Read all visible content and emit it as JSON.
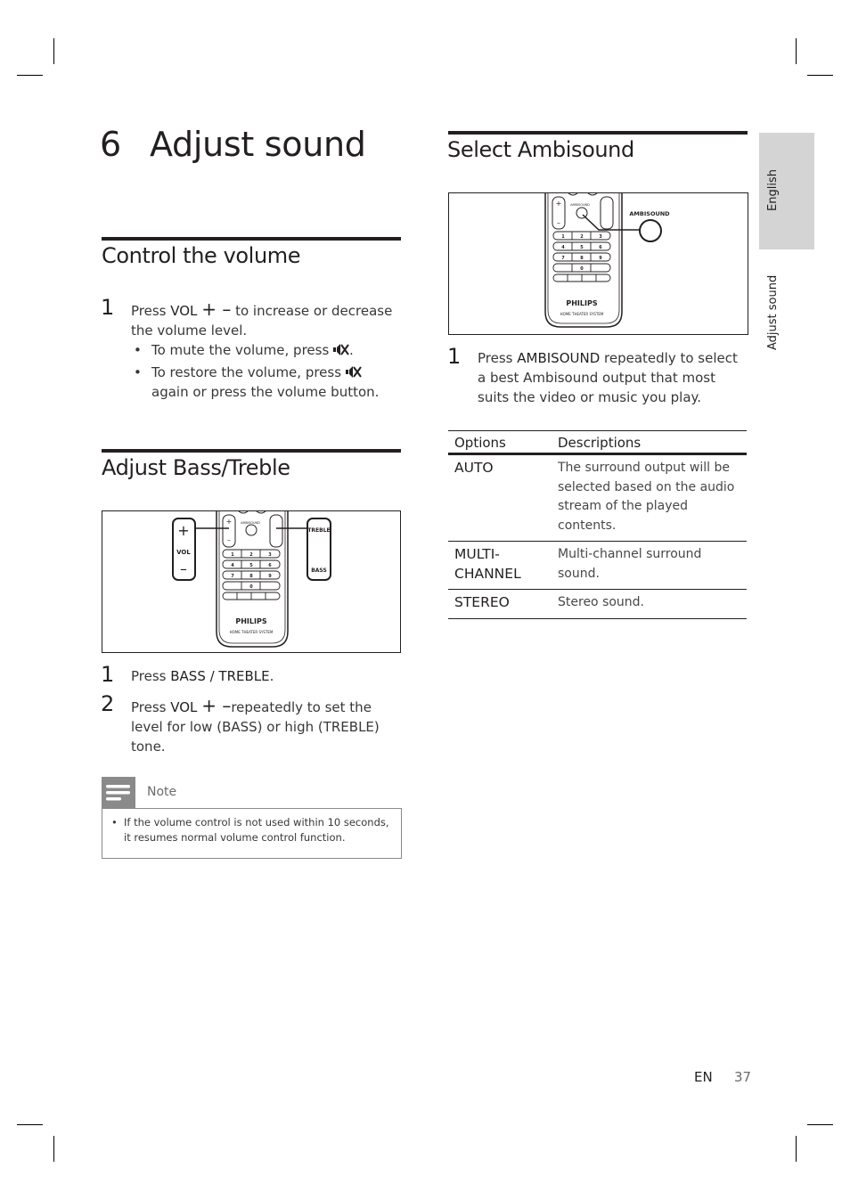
{
  "chapter": {
    "number": "6",
    "title": "Adjust sound"
  },
  "side_tabs": {
    "language": "English",
    "section": "Adjust sound"
  },
  "control_volume": {
    "title": "Control the volume",
    "step1": {
      "num": "1",
      "press": "Press ",
      "key": "VOL",
      "symbols": "+ –",
      "rest": " to increase or decrease the volume level."
    },
    "bullets": [
      {
        "text": "To mute the volume, press ",
        "icon": "mute-icon",
        "after": "."
      },
      {
        "text": "To restore the volume, press ",
        "icon": "mute-icon",
        "after": " again or press the volume button."
      }
    ]
  },
  "bass_treble": {
    "title": "Adjust Bass/Treble",
    "figure": {
      "vol_label": "VOL",
      "plus": "+",
      "minus": "–",
      "treble_label": "TREBLE",
      "bass_label": "BASS",
      "remote_brand": "PHILIPS",
      "remote_sub": "HOME THEATER SYSTEM",
      "remote_ambisound": "AMBISOUND",
      "keypad": [
        "1",
        "2",
        "3",
        "4",
        "5",
        "6",
        "7",
        "8",
        "9",
        "",
        "0",
        ""
      ]
    },
    "steps": [
      {
        "num": "1",
        "press": "Press ",
        "key": "BASS / TREBLE",
        "rest": "."
      },
      {
        "num": "2",
        "press": "Press ",
        "key": "VOL",
        "symbols": "+ –",
        "rest": "repeatedly to set the level for low (BASS) or high (TREBLE) tone."
      }
    ],
    "note": {
      "label": "Note",
      "icon": "note-icon",
      "items": [
        "If the volume control is not used within 10 seconds, it resumes normal volume control function."
      ]
    }
  },
  "ambisound": {
    "title": "Select Ambisound",
    "figure": {
      "callout_label": "AMBISOUND",
      "remote_brand": "PHILIPS",
      "remote_sub": "HOME THEATER SYSTEM",
      "keypad": [
        "1",
        "2",
        "3",
        "4",
        "5",
        "6",
        "7",
        "8",
        "9",
        "",
        "0",
        ""
      ]
    },
    "step1": {
      "num": "1",
      "press": "Press ",
      "key": "AMBISOUND",
      "rest": " repeatedly to select a best Ambisound output that most suits the video or music you play."
    },
    "table": {
      "headers": [
        "Options",
        "Descriptions"
      ],
      "rows": [
        {
          "option": "AUTO",
          "description": "The surround output will be selected based on the audio stream of the played contents."
        },
        {
          "option": "MULTI-\nCHANNEL",
          "description": "Multi-channel surround sound."
        },
        {
          "option": "STEREO",
          "description": "Stereo sound."
        }
      ]
    }
  },
  "footer": {
    "lang": "EN",
    "page": "37"
  }
}
